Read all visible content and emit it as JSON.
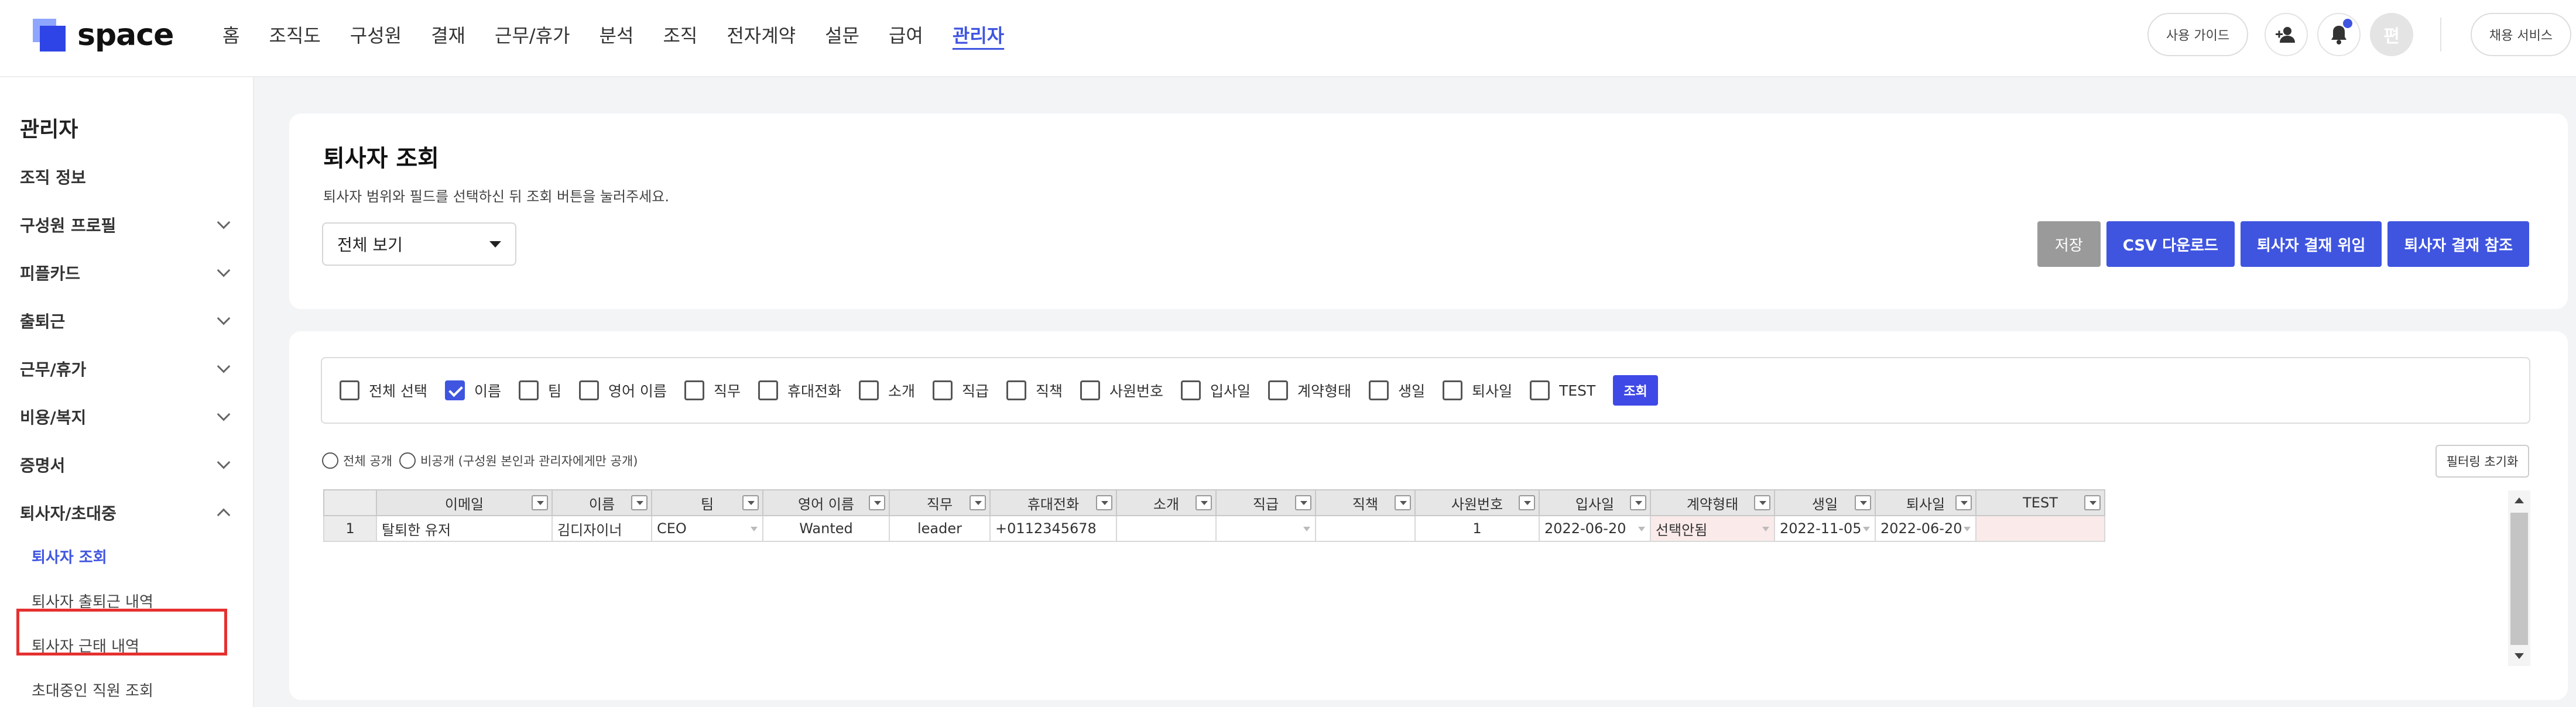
{
  "app": {
    "logo_text": "space"
  },
  "nav": [
    "홈",
    "조직도",
    "구성원",
    "결재",
    "근무/휴가",
    "분석",
    "조직",
    "전자계약",
    "설문",
    "급여",
    "관리자"
  ],
  "top_right": {
    "guide_label": "사용 가이드",
    "hire_label": "채용 서비스",
    "avatar_initial": "편"
  },
  "sidebar": {
    "title": "관리자",
    "items": [
      "조직 정보",
      "구성원 프로필",
      "피플카드",
      "출퇴근",
      "근무/휴가",
      "비용/복지",
      "증명서",
      "퇴사자/초대중"
    ],
    "subitems": [
      "퇴사자 조회",
      "퇴사자 출퇴근 내역",
      "퇴사자 근태 내역",
      "초대중인 직원 조회"
    ]
  },
  "header": {
    "title": "퇴사자 조회",
    "description": "퇴사자 범위와 필드를 선택하신 뒤 조회 버튼을 눌러주세요.",
    "select_value": "전체 보기",
    "buttons": {
      "save": "저장",
      "csv": "CSV 다운로드",
      "delegate": "퇴사자 결재 위임",
      "reference": "퇴사자 결재 참조"
    }
  },
  "fields": {
    "items": [
      {
        "label": "전체 선택",
        "checked": false
      },
      {
        "label": "이름",
        "checked": true
      },
      {
        "label": "팀",
        "checked": false
      },
      {
        "label": "영어 이름",
        "checked": false
      },
      {
        "label": "직무",
        "checked": false
      },
      {
        "label": "휴대전화",
        "checked": false
      },
      {
        "label": "소개",
        "checked": false
      },
      {
        "label": "직급",
        "checked": false
      },
      {
        "label": "직책",
        "checked": false
      },
      {
        "label": "사원번호",
        "checked": false
      },
      {
        "label": "입사일",
        "checked": false
      },
      {
        "label": "계약형태",
        "checked": false
      },
      {
        "label": "생일",
        "checked": false
      },
      {
        "label": "퇴사일",
        "checked": false
      },
      {
        "label": "TEST",
        "checked": false
      }
    ],
    "search_label": "조회"
  },
  "visibility": {
    "public_label": "전체 공개",
    "private_label": "비공개 (구성원 본인과 관리자에게만 공개)"
  },
  "filter_reset_label": "필터링 초기화",
  "table": {
    "columns": [
      "이메일",
      "이름",
      "팀",
      "영어 이름",
      "직무",
      "휴대전화",
      "소개",
      "직급",
      "직책",
      "사원번호",
      "입사일",
      "계약형태",
      "생일",
      "퇴사일",
      "TEST"
    ],
    "rows": [
      [
        "1",
        "탈퇴한 유저",
        "김디자이너",
        "CEO",
        "Wanted",
        "leader",
        "+0112345678",
        "",
        "",
        "",
        "1",
        "2022-06-20",
        "선택안됨",
        "2022-11-05",
        "2022-06-20",
        ""
      ]
    ]
  }
}
